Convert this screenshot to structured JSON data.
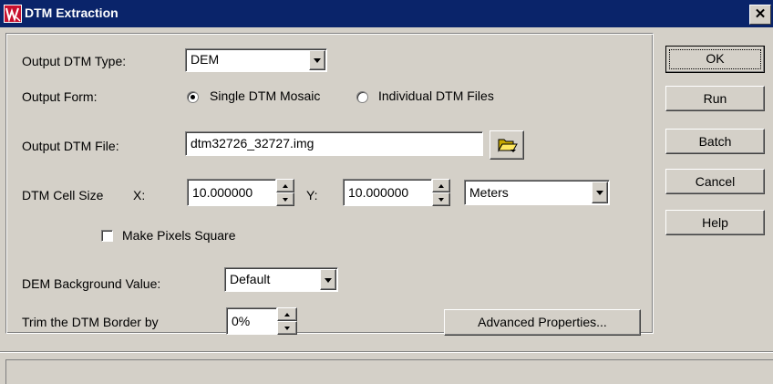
{
  "window": {
    "title": "DTM Extraction",
    "close_symbol": "✕",
    "icon": "app-logo-icon"
  },
  "colors": {
    "titlebar": "#0a246a",
    "dialog_bg": "#d4d0c8",
    "icon_red": "#c8102e"
  },
  "form": {
    "output_type_label": "Output DTM Type:",
    "output_type_value": "DEM",
    "output_form_label": "Output Form:",
    "output_form_options": [
      "Single DTM Mosaic",
      "Individual DTM Files"
    ],
    "output_form_selected": "Single DTM Mosaic",
    "output_file_label": "Output DTM File:",
    "output_file_value": "dtm32726_32727.img",
    "cell_size_label": "DTM Cell Size",
    "x_label": "X:",
    "x_value": "10.000000",
    "y_label": "Y:",
    "y_value": "10.000000",
    "units_value": "Meters",
    "make_square_label": "Make Pixels Square",
    "make_square_checked": false,
    "bg_value_label": "DEM Background Value:",
    "bg_value": "Default",
    "trim_label": "Trim the DTM Border by",
    "trim_value": "0%",
    "advanced_button": "Advanced Properties..."
  },
  "buttons": {
    "ok": "OK",
    "run": "Run",
    "batch": "Batch",
    "cancel": "Cancel",
    "help": "Help"
  },
  "statusbar": {
    "text": ""
  }
}
